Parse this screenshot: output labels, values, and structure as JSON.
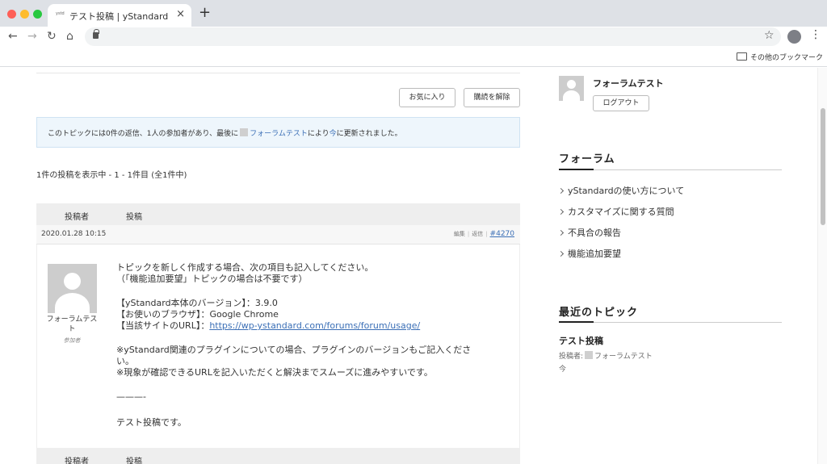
{
  "browser": {
    "tab_favicon": "ystd",
    "tab_title": "テスト投稿 | yStandard",
    "tab_close": "×",
    "new_tab": "+",
    "back": "←",
    "forward": "→",
    "reload": "↻",
    "home": "⌂",
    "star": "☆",
    "menu": "⋮",
    "bookmark_folder_label": "その他のブックマーク"
  },
  "topic_actions": {
    "favorite_label": "お気に入り",
    "unsubscribe_label": "購読を解除"
  },
  "notice": {
    "prefix": "このトピックには0件の返信、1人の参加者があり、最後に",
    "author_link": "フォーラムテスト",
    "suffix": "により",
    "time_link": "今",
    "end": "に更新されました。"
  },
  "pagination_count": "1件の投稿を表示中 - 1 - 1件目 (全1件中)",
  "table": {
    "col_author": "投稿者",
    "col_post": "投稿"
  },
  "post": {
    "date": "2020.01.28 10:15",
    "edit_label": "編集",
    "reply_label": "返信",
    "number": "#4270",
    "author_name": "フォーラムテスト",
    "author_role": "参加者",
    "lines": [
      "トピックを新しく作成する場合、次の項目も記入してください。",
      "（「機能追加要望」トピックの場合は不要です）",
      "【yStandard本体のバージョン】：3.9.0",
      "【お使いのブラウザ】：Google Chrome",
      "【当該サイトのURL】：",
      "※yStandard関連のプラグインについての場合、プラグインのバージョンもご記入くださ",
      "い。",
      "※現象が確認できるURLを記入いただくと解決までスムーズに進みやすいです。",
      "———-",
      "テスト投稿です。"
    ],
    "url_link": "https://wp-ystandard.com/forums/forum/usage/"
  },
  "sidebar": {
    "user_name": "フォーラムテスト",
    "logout_label": "ログアウト",
    "forum_heading": "フォーラム",
    "forums": [
      "yStandardの使い方について",
      "カスタマイズに関する質問",
      "不具合の報告",
      "機能追加要望"
    ],
    "recent_heading": "最近のトピック",
    "recent_topic_title": "テスト投稿",
    "recent_topic_by": "投稿者:",
    "recent_topic_author": "フォーラムテスト",
    "recent_topic_time": "今"
  },
  "colors": {
    "link": "#3b6fb6",
    "notice_bg": "#eef6fc",
    "table_header_bg": "#eeeeee"
  }
}
